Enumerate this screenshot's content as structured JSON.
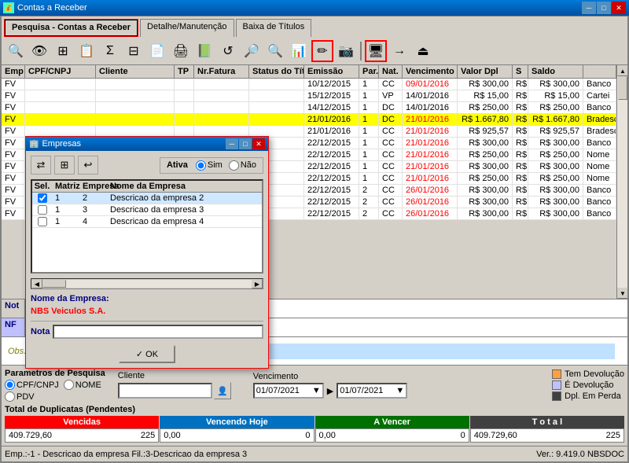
{
  "titleBar": {
    "title": "Contas a Receber",
    "minimize": "─",
    "maximize": "□",
    "close": "✕"
  },
  "tabs": [
    {
      "label": "Pesquisa - Contas a Receber",
      "active": true
    },
    {
      "label": "Detalhe/Manutenção",
      "active": false
    },
    {
      "label": "Baixa de Títulos",
      "active": false
    }
  ],
  "toolbar": {
    "buttons": [
      "🔍",
      "👁",
      "⊞",
      "📋",
      "Σ",
      "⊟",
      "📄",
      "🖨",
      "📗",
      "↺",
      "🔎",
      "🔍",
      "📊",
      "✏",
      "📷",
      "🖥",
      "→",
      "⏏"
    ]
  },
  "gridHeaders": [
    "Emp",
    "CPF/CNPJ",
    "Cliente",
    "TP",
    "Nr.Fatura",
    "Status do Título",
    "Emissão",
    "Par.",
    "Nat.",
    "Vencimento",
    "Valor Dpl",
    "S",
    "Saldo",
    ""
  ],
  "gridRows": [
    {
      "emp": "FV",
      "cpf": "",
      "cliente": "",
      "tp": "",
      "nr": "",
      "status": "",
      "emissao": "10/12/2015",
      "par": "1",
      "nat": "CC",
      "venc": "09/01/2016",
      "valordpl": "R$ 300,00",
      "s": "R$",
      "saldo": "R$ 300,00",
      "banco": "Banco",
      "vencColor": "red",
      "rowBg": "white"
    },
    {
      "emp": "FV",
      "cpf": "",
      "cliente": "",
      "tp": "",
      "nr": "",
      "status": "",
      "emissao": "15/12/2015",
      "par": "1",
      "nat": "VP",
      "venc": "14/01/2016",
      "valordpl": "R$ 15,00",
      "s": "R$",
      "saldo": "R$ 15,00",
      "banco": "Cartei",
      "vencColor": "black",
      "rowBg": "white"
    },
    {
      "emp": "FV",
      "cpf": "",
      "cliente": "",
      "tp": "",
      "nr": "",
      "status": "",
      "emissao": "14/12/2015",
      "par": "1",
      "nat": "DC",
      "venc": "14/01/2016",
      "valordpl": "R$ 250,00",
      "s": "R$",
      "saldo": "R$ 250,00",
      "banco": "Banco",
      "vencColor": "black",
      "rowBg": "white"
    },
    {
      "emp": "FV",
      "cpf": "",
      "cliente": "",
      "tp": "",
      "nr": "",
      "status": "",
      "emissao": "21/01/2016",
      "par": "1",
      "nat": "DC",
      "venc": "21/01/2016",
      "valordpl": "R$ 1.667,80",
      "s": "R$",
      "saldo": "R$ 1.667,80",
      "banco": "Bradesc",
      "vencColor": "red",
      "rowBg": "yellow"
    },
    {
      "emp": "FV",
      "cpf": "",
      "cliente": "",
      "tp": "",
      "nr": "",
      "status": "",
      "emissao": "21/01/2016",
      "par": "1",
      "nat": "CC",
      "venc": "21/01/2016",
      "valordpl": "R$ 925,57",
      "s": "R$",
      "saldo": "R$ 925,57",
      "banco": "Bradesc",
      "vencColor": "red",
      "rowBg": "white"
    },
    {
      "emp": "FV",
      "cpf": "",
      "cliente": "",
      "tp": "",
      "nr": "",
      "status": "",
      "emissao": "22/12/2015",
      "par": "1",
      "nat": "CC",
      "venc": "21/01/2016",
      "valordpl": "R$ 300,00",
      "s": "R$",
      "saldo": "R$ 300,00",
      "banco": "Banco",
      "vencColor": "red",
      "rowBg": "white"
    },
    {
      "emp": "FV",
      "cpf": "",
      "cliente": "",
      "tp": "",
      "nr": "",
      "status": "",
      "emissao": "22/12/2015",
      "par": "1",
      "nat": "CC",
      "venc": "21/01/2016",
      "valordpl": "R$ 250,00",
      "s": "R$",
      "saldo": "R$ 250,00",
      "banco": "Nome",
      "vencColor": "red",
      "rowBg": "white"
    },
    {
      "emp": "FV",
      "cpf": "",
      "cliente": "",
      "tp": "",
      "nr": "",
      "status": "",
      "emissao": "22/12/2015",
      "par": "1",
      "nat": "CC",
      "venc": "21/01/2016",
      "valordpl": "R$ 300,00",
      "s": "R$",
      "saldo": "R$ 300,00",
      "banco": "Nome",
      "vencColor": "red",
      "rowBg": "white"
    },
    {
      "emp": "FV",
      "cpf": "",
      "cliente": "",
      "tp": "",
      "nr": "",
      "status": "",
      "emissao": "22/12/2015",
      "par": "1",
      "nat": "CC",
      "venc": "21/01/2016",
      "valordpl": "R$ 250,00",
      "s": "R$",
      "saldo": "R$ 250,00",
      "banco": "Nome",
      "vencColor": "red",
      "rowBg": "white"
    },
    {
      "emp": "FV",
      "cpf": "",
      "cliente": "",
      "tp": "",
      "nr": "",
      "status": "",
      "emissao": "22/12/2015",
      "par": "2",
      "nat": "CC",
      "venc": "26/01/2016",
      "valordpl": "R$ 300,00",
      "s": "R$",
      "saldo": "R$ 300,00",
      "banco": "Banco",
      "vencColor": "red",
      "rowBg": "white"
    },
    {
      "emp": "FV",
      "cpf": "",
      "cliente": "",
      "tp": "",
      "nr": "",
      "status": "",
      "emissao": "22/12/2015",
      "par": "2",
      "nat": "CC",
      "venc": "26/01/2016",
      "valordpl": "R$ 300,00",
      "s": "R$",
      "saldo": "R$ 300,00",
      "banco": "Banco",
      "vencColor": "red",
      "rowBg": "white"
    },
    {
      "emp": "FV",
      "cpf": "",
      "cliente": "",
      "tp": "",
      "nr": "",
      "status": "",
      "emissao": "22/12/2015",
      "par": "2",
      "nat": "CC",
      "venc": "26/01/2016",
      "valordpl": "R$ 300,00",
      "s": "R$",
      "saldo": "R$ 300,00",
      "banco": "Banco",
      "vencColor": "red",
      "rowBg": "white"
    }
  ],
  "notesRow": {
    "label": "Not",
    "nfLabel": "NF",
    "obsLabel": "Obs."
  },
  "params": {
    "title": "Parametros de Pesquisa",
    "radio1": "CPF/CNPJ",
    "radio2": "NOME",
    "radio3": "PDV",
    "clienteLabel": "Cliente",
    "vencimentoLabel": "Vencimento",
    "venc1": "01/07/2021",
    "venc2": "01/07/2021"
  },
  "legend": {
    "items": [
      {
        "label": "Tem Devolução",
        "color": "#ffa040"
      },
      {
        "label": "É Devolução",
        "color": "#c0c0ff"
      },
      {
        "label": "Dpl. Em Perda",
        "color": "#404040"
      }
    ]
  },
  "totals": {
    "labels": [
      "Vencidas",
      "Vencendo Hoje",
      "A Vencer",
      "T o t a l"
    ],
    "values": [
      {
        "amount": "409.729,60",
        "count": "225"
      },
      {
        "amount": "0,00",
        "count": "0"
      },
      {
        "amount": "0,00",
        "count": "0"
      },
      {
        "amount": "409.729,60",
        "count": "225"
      }
    ],
    "colors": [
      "red",
      "#0070c0",
      "#007000",
      "#404040"
    ]
  },
  "statusBar": {
    "left": "Emp.:-1 - Descricao da empresa Fil.:3-Descricao da empresa 3",
    "right": "Ver.: 9.419.0  NBSDOC"
  },
  "modal": {
    "title": "Empresas",
    "minimize": "─",
    "maximize": "□",
    "close": "✕",
    "ativaLabel": "Ativa",
    "simLabel": "Sim",
    "naoLabel": "Não",
    "columns": [
      "Sel.",
      "Matriz",
      "Empresa",
      "Nome da Empresa"
    ],
    "rows": [
      {
        "sel": true,
        "matriz": "1",
        "empresa": "2",
        "nome": "Descricao da empresa 2",
        "selected": true
      },
      {
        "sel": false,
        "matriz": "1",
        "empresa": "3",
        "nome": "Descricao da empresa 3",
        "selected": false
      },
      {
        "sel": false,
        "matriz": "1",
        "empresa": "4",
        "nome": "Descricao da empresa 4",
        "selected": false
      }
    ],
    "empresaNomeLabel": "Nome da Empresa:",
    "empresaNomeValue": "NBS Veiculos S.A.",
    "notaLabel": "Nota",
    "okLabel": "✓ OK"
  }
}
